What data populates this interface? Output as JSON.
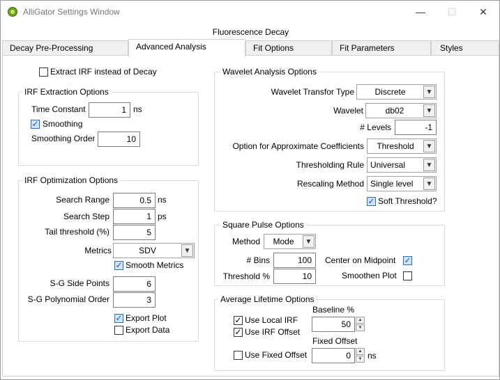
{
  "window": {
    "title": "AlliGator Settings Window",
    "minimize": "—",
    "maximize": "☐",
    "close": "✕"
  },
  "section_title": "Fluorescence Decay",
  "tabs": [
    "Decay Pre-Processing",
    "Advanced Analysis",
    "Fit Options",
    "Fit Parameters",
    "Styles"
  ],
  "active_tab": "Advanced Analysis",
  "left": {
    "extract_irf_label": "Extract IRF instead of Decay",
    "extract_irf_checked": false,
    "irf_extraction": {
      "title": "IRF Extraction Options",
      "time_constant_label": "Time Constant",
      "time_constant_value": "1",
      "time_constant_unit": "ns",
      "smoothing_label": "Smoothing",
      "smoothing_checked": true,
      "smoothing_order_label": "Smoothing Order",
      "smoothing_order_value": "10"
    },
    "irf_optimization": {
      "title": "IRF Optimization Options",
      "search_range_label": "Search Range",
      "search_range_value": "0.5",
      "search_range_unit": "ns",
      "search_step_label": "Search Step",
      "search_step_value": "1",
      "search_step_unit": "ps",
      "tail_threshold_label": "Tail threshold (%)",
      "tail_threshold_value": "5",
      "metrics_label": "Metrics",
      "metrics_value": "SDV",
      "smooth_metrics_label": "Smooth Metrics",
      "smooth_metrics_checked": true,
      "sg_side_points_label": "S-G Side Points",
      "sg_side_points_value": "6",
      "sg_poly_order_label": "S-G Polynomial Order",
      "sg_poly_order_value": "3",
      "export_plot_label": "Export Plot",
      "export_plot_checked": true,
      "export_data_label": "Export Data",
      "export_data_checked": false
    }
  },
  "right": {
    "wavelet": {
      "title": "Wavelet Analysis Options",
      "transform_type_label": "Wavelet Transfor Type",
      "transform_type_value": "Discrete",
      "wavelet_label": "Wavelet",
      "wavelet_value": "db02",
      "levels_label": "# Levels",
      "levels_value": "-1",
      "approx_coeff_label": "Option for Approximate Coefficients",
      "approx_coeff_value": "Threshold",
      "thresholding_rule_label": "Thresholding Rule",
      "thresholding_rule_value": "Universal",
      "rescaling_label": "Rescaling Method",
      "rescaling_value": "Single level",
      "soft_threshold_label": "Soft Threshold?",
      "soft_threshold_checked": true
    },
    "square_pulse": {
      "title": "Square Pulse Options",
      "method_label": "Method",
      "method_value": "Mode",
      "bins_label": "# Bins",
      "bins_value": "100",
      "threshold_label": "Threshold %",
      "threshold_value": "10",
      "center_label": "Center on Midpoint",
      "center_checked": true,
      "smoothen_label": "Smoothen Plot",
      "smoothen_checked": false
    },
    "average_lifetime": {
      "title": "Average Lifetime Options",
      "use_local_irf_label": "Use Local IRF",
      "use_local_irf_checked": true,
      "use_irf_offset_label": "Use IRF Offset",
      "use_irf_offset_checked": true,
      "baseline_label": "Baseline %",
      "baseline_value": "50",
      "fixed_offset_label": "Fixed Offset",
      "fixed_offset_value": "0",
      "fixed_offset_unit": "ns",
      "use_fixed_offset_label": "Use Fixed Offset",
      "use_fixed_offset_checked": false
    }
  },
  "icons": {
    "checkmark": "✓",
    "dropdown": "▼",
    "spin_up": "▲",
    "spin_down": "▼"
  }
}
